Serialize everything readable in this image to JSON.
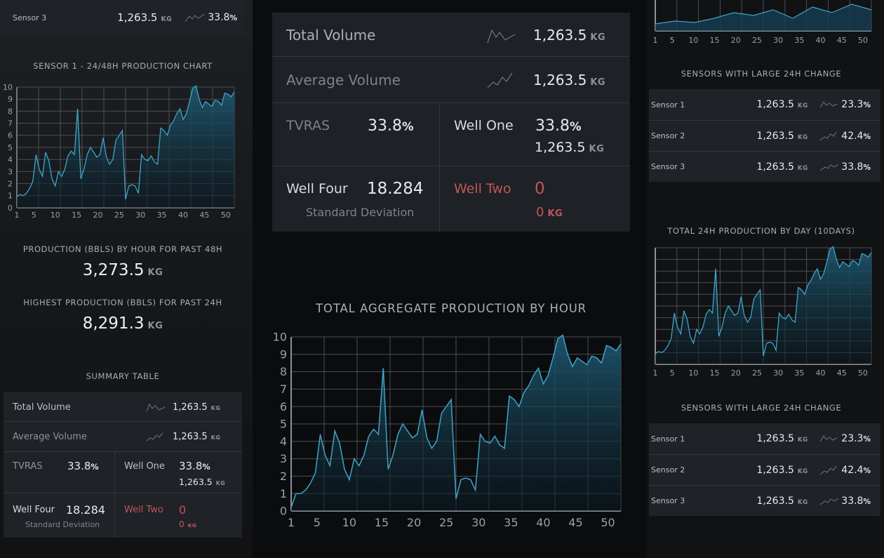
{
  "left": {
    "sensor3_row": {
      "label": "Sensor 3",
      "value": "1,263.5",
      "unit": "KG",
      "pct": "33.8",
      "pct_sign": "%"
    },
    "chart_title": "SENSOR 1 - 24/48H PRODUCTION CHART",
    "prod_title": "PRODUCTION (BBLS) BY HOUR FOR PAST 48H",
    "prod_value": "3,273.5",
    "prod_unit": "KG",
    "highest_title": "HIGHEST PRODUCTION (BBLS) FOR PAST 24H",
    "highest_value": "8,291.3",
    "highest_unit": "KG",
    "summary_title": "SUMMARY TABLE"
  },
  "summary": {
    "total_volume_label": "Total Volume",
    "total_volume_value": "1,263.5",
    "total_volume_unit": "KG",
    "avg_volume_label": "Average Volume",
    "avg_volume_value": "1,263.5",
    "avg_volume_unit": "KG",
    "tvras_label": "TVRAS",
    "tvras_value": "33.8",
    "tvras_sign": "%",
    "well_one_label": "Well One",
    "well_one_pct": "33.8",
    "well_one_sign": "%",
    "well_one_value": "1,263.5",
    "well_one_unit": "KG",
    "well_four_label": "Well Four",
    "well_four_value": "18.284",
    "std_dev_label": "Standard Deviation",
    "well_two_label": "Well Two",
    "well_two_value": "0",
    "well_two_sub": "0",
    "well_two_unit": "KG"
  },
  "center": {
    "chart_title": "TOTAL AGGREGATE PRODUCTION BY HOUR"
  },
  "right": {
    "sensors_title_1": "SENSORS WITH LARGE 24H CHANGE",
    "sensors_title_2": "SENSORS WITH LARGE 24H CHANGE",
    "daily_title": "TOTAL 24H PRODUCTION BY DAY (10DAYS)",
    "sensors": [
      {
        "label": "Sensor 1",
        "value": "1,263.5",
        "unit": "KG",
        "pct": "23.3",
        "sign": "%"
      },
      {
        "label": "Sensor 2",
        "value": "1,263.5",
        "unit": "KG",
        "pct": "42.4",
        "sign": "%"
      },
      {
        "label": "Sensor 3",
        "value": "1,263.5",
        "unit": "KG",
        "pct": "33.8",
        "sign": "%"
      }
    ]
  },
  "colors": {
    "accent": "#3fa4c8",
    "fill_top": "#1e5a73",
    "grid": "#4a5057",
    "red": "#c0575a"
  },
  "chart_data": [
    {
      "type": "area",
      "name": "sensor1",
      "title": "SENSOR 1 - 24/48H PRODUCTION CHART",
      "x_ticks": [
        1,
        5,
        10,
        15,
        20,
        25,
        30,
        35,
        40,
        45,
        50
      ],
      "y_ticks": [
        0,
        1,
        2,
        3,
        4,
        5,
        6,
        7,
        8,
        9,
        10
      ],
      "xlim": [
        1,
        52
      ],
      "ylim": [
        0,
        10
      ],
      "y": [
        0.9,
        1.1,
        1.0,
        1.2,
        1.6,
        2.2,
        4.4,
        3.2,
        2.6,
        4.6,
        3.9,
        2.4,
        1.8,
        3.0,
        2.6,
        3.2,
        4.3,
        4.7,
        4.4,
        8.2,
        2.4,
        3.2,
        4.4,
        5.0,
        4.6,
        4.2,
        4.4,
        5.8,
        4.2,
        3.6,
        4.0,
        5.6,
        6.0,
        6.4,
        0.7,
        1.8,
        1.9,
        1.8,
        1.2,
        4.4,
        4.0,
        3.9,
        4.3,
        3.8,
        3.6,
        6.6,
        6.4,
        6.0,
        6.8,
        7.2,
        7.8,
        8.2,
        7.3,
        7.8,
        8.8,
        9.9,
        10.1,
        9.0,
        8.3,
        8.8,
        8.6,
        8.4,
        8.9,
        8.8,
        8.5,
        9.5,
        9.4,
        9.2,
        9.6
      ]
    },
    {
      "type": "area",
      "name": "aggregate",
      "title": "TOTAL AGGREGATE PRODUCTION BY HOUR",
      "x_ticks": [
        1,
        5,
        10,
        15,
        20,
        25,
        30,
        35,
        40,
        45,
        50
      ],
      "y_ticks": [
        0,
        1,
        2,
        3,
        4,
        5,
        6,
        7,
        8,
        9,
        10
      ],
      "xlim": [
        1,
        52
      ],
      "ylim": [
        0,
        10
      ],
      "y": [
        0.2,
        1.0,
        1.0,
        1.2,
        1.6,
        2.2,
        4.4,
        3.2,
        2.6,
        4.6,
        3.9,
        2.4,
        1.8,
        3.0,
        2.6,
        3.2,
        4.3,
        4.7,
        4.4,
        8.2,
        2.4,
        3.2,
        4.4,
        5.0,
        4.6,
        4.2,
        4.4,
        5.8,
        4.2,
        3.6,
        4.0,
        5.6,
        6.0,
        6.4,
        0.7,
        1.8,
        1.9,
        1.8,
        1.2,
        4.4,
        4.0,
        3.9,
        4.3,
        3.8,
        3.6,
        6.6,
        6.4,
        6.0,
        6.8,
        7.2,
        7.8,
        8.2,
        7.3,
        7.8,
        8.8,
        9.9,
        10.1,
        9.0,
        8.3,
        8.8,
        8.6,
        8.4,
        8.9,
        8.8,
        8.5,
        9.5,
        9.4,
        9.2,
        9.6
      ]
    },
    {
      "type": "area",
      "name": "top-right",
      "x_ticks": [
        1,
        5,
        10,
        15,
        20,
        25,
        30,
        35,
        40,
        45,
        50
      ],
      "xlim": [
        1,
        52
      ],
      "y": [
        2,
        3,
        2.5,
        4,
        6,
        5,
        7,
        4,
        8,
        6,
        9,
        7
      ]
    },
    {
      "type": "area",
      "name": "daily",
      "title": "TOTAL 24H PRODUCTION BY DAY (10DAYS)",
      "x_ticks": [
        1,
        5,
        10,
        15,
        20,
        25,
        30,
        35,
        40,
        45,
        50
      ],
      "xlim": [
        1,
        52
      ],
      "ylim": [
        0,
        10
      ],
      "y": [
        0.9,
        1.1,
        1.0,
        1.2,
        1.6,
        2.2,
        4.4,
        3.2,
        2.6,
        4.6,
        3.9,
        2.4,
        1.8,
        3.0,
        2.6,
        3.2,
        4.3,
        4.7,
        4.4,
        8.2,
        2.4,
        3.2,
        4.4,
        5.0,
        4.6,
        4.2,
        4.4,
        5.8,
        4.2,
        3.6,
        4.0,
        5.6,
        6.0,
        6.4,
        0.7,
        1.8,
        1.9,
        1.8,
        1.2,
        4.4,
        4.0,
        3.9,
        4.3,
        3.8,
        3.6,
        6.6,
        6.4,
        6.0,
        6.8,
        7.2,
        7.8,
        8.2,
        7.3,
        7.8,
        8.8,
        9.9,
        10.1,
        9.0,
        8.3,
        8.8,
        8.6,
        8.4,
        8.9,
        8.8,
        8.5,
        9.5,
        9.4,
        9.2,
        9.6
      ]
    }
  ]
}
